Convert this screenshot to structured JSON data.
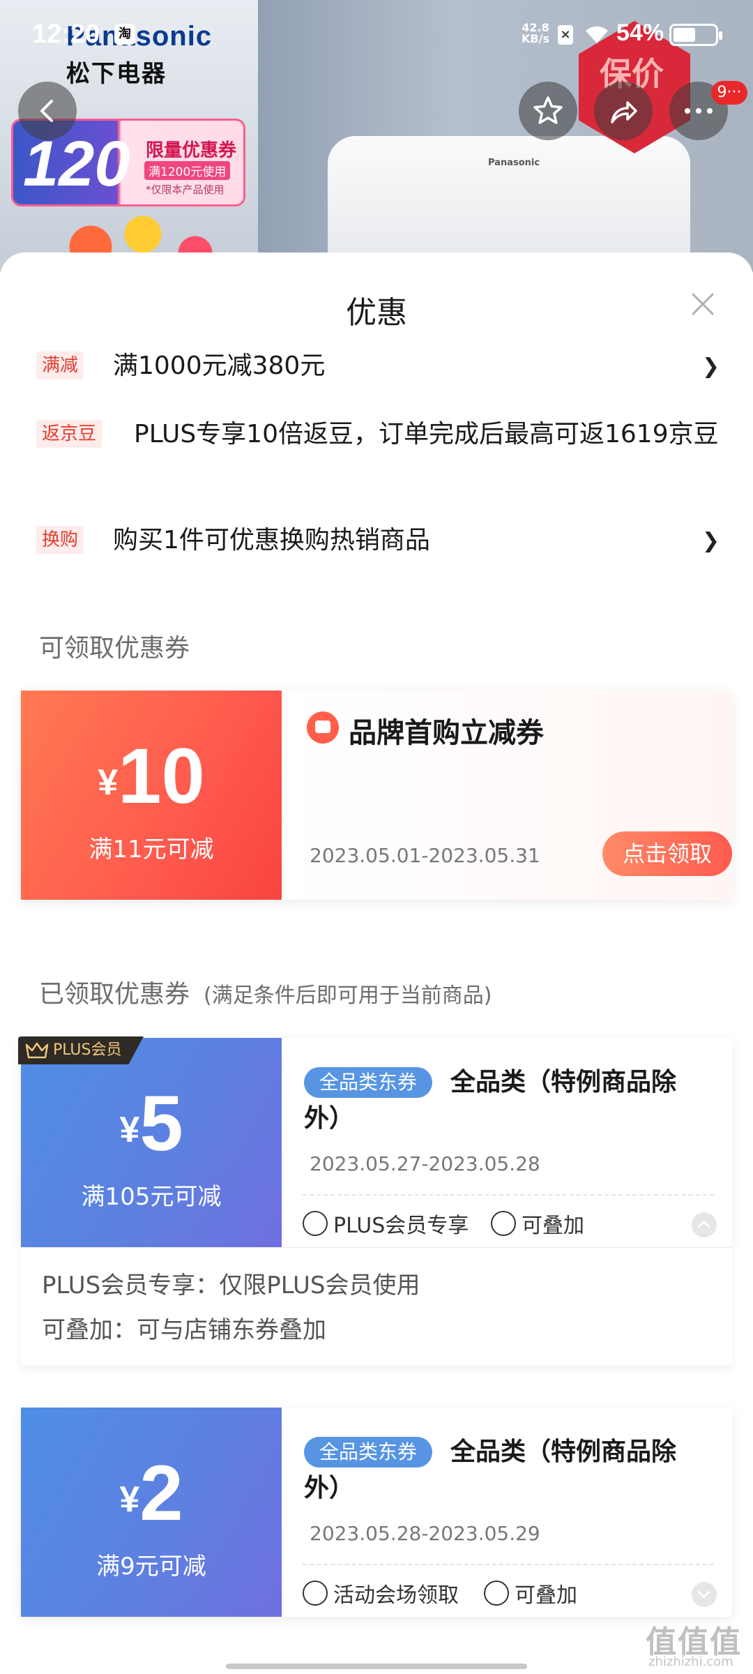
{
  "status_bar": {
    "time": "12:20",
    "taobao_icon": "淘",
    "net_speed_value": "42.8",
    "net_speed_unit": "KB/s",
    "battery_text": "54%",
    "battery_level": 0.54
  },
  "hero": {
    "brand_en": "Panasonic",
    "brand_cn": "松下电器",
    "promo_amount": "120",
    "promo_title": "限量优惠券",
    "promo_sub": "满1200元使用",
    "promo_note": "*仅限本产品使用",
    "product_brand": "Panasonic",
    "price_badge": "保价",
    "message_badge": "9···"
  },
  "sheet": {
    "title": "优惠",
    "promotions": [
      {
        "tag": "满减",
        "text": "满1000元减380元",
        "has_arrow": true
      },
      {
        "tag": "返京豆",
        "text": "PLUS专享10倍返豆，订单完成后最高可返1619京豆",
        "has_arrow": false
      },
      {
        "tag": "换购",
        "text": "购买1件可优惠换购热销商品",
        "has_arrow": true
      }
    ],
    "claimable_title": "可领取优惠券",
    "claimable": {
      "currency": "¥",
      "amount": "10",
      "condition": "满11元可减",
      "name": "品牌首购立减券",
      "date": "2023.05.01-2023.05.31",
      "button": "点击领取"
    },
    "claimed_title": "已领取优惠券",
    "claimed_sub": "(满足条件后即可用于当前商品)",
    "claimed": [
      {
        "badge": "PLUS会员",
        "currency": "¥",
        "amount": "5",
        "condition": "满105元可减",
        "tag": "全品类东券",
        "desc": "全品类（特例商品除外）",
        "date": "2023.05.27-2023.05.28",
        "feature1": "PLUS会员专享",
        "feature2": "可叠加",
        "detail1": "PLUS会员专享：仅限PLUS会员使用",
        "detail2": "可叠加：可与店铺东券叠加"
      },
      {
        "currency": "¥",
        "amount": "2",
        "condition": "满9元可减",
        "tag": "全品类东券",
        "desc": "全品类（特例商品除外）",
        "date": "2023.05.28-2023.05.29",
        "feature1": "活动会场领取",
        "feature2": "可叠加"
      }
    ]
  },
  "watermark": {
    "main": "值值值",
    "sub": "zhizhizhi.com"
  }
}
